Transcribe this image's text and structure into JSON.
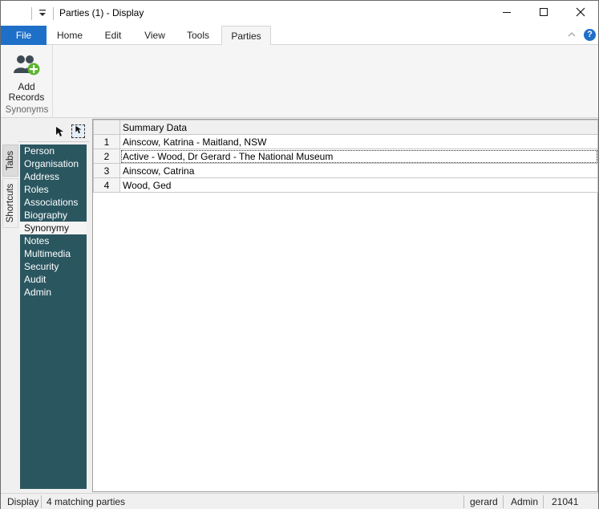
{
  "window": {
    "title": "Parties (1) - Display",
    "quick_access_dropdown_icon": "dropdown-arrow-icon",
    "controls": {
      "minimize": "—",
      "maximize": "☐",
      "close": "✕"
    }
  },
  "ribbon": {
    "tabs": [
      {
        "label": "File"
      },
      {
        "label": "Home"
      },
      {
        "label": "Edit"
      },
      {
        "label": "View"
      },
      {
        "label": "Tools"
      },
      {
        "label": "Parties"
      }
    ],
    "active_tab": "Parties",
    "collapse_icon": "^",
    "help_icon": "?",
    "groups": [
      {
        "label": "Synonyms",
        "buttons": [
          {
            "label_line1": "Add",
            "label_line2": "Records",
            "icon": "add-people-icon"
          }
        ]
      }
    ],
    "colors": {
      "file_tab": "#1e6fc8",
      "add_icon_people": "#3d4a52",
      "add_icon_plus": "#5cb531"
    }
  },
  "sidebar": {
    "vertical_tabs": [
      {
        "label": "Tabs"
      },
      {
        "label": "Shortcuts"
      }
    ],
    "tools": {
      "pointer": "↖",
      "select": "⇱"
    },
    "items": [
      {
        "label": "Person"
      },
      {
        "label": "Organisation"
      },
      {
        "label": "Address"
      },
      {
        "label": "Roles"
      },
      {
        "label": "Associations"
      },
      {
        "label": "Biography"
      },
      {
        "label": "Synonymy"
      },
      {
        "label": "Notes"
      },
      {
        "label": "Multimedia"
      },
      {
        "label": "Security"
      },
      {
        "label": "Audit"
      },
      {
        "label": "Admin"
      }
    ],
    "active_item": "Synonymy",
    "colors": {
      "background": "#2a5660",
      "active_background": "#f4f4f4"
    }
  },
  "grid": {
    "column_header": "Summary Data",
    "rows": [
      {
        "num": "1",
        "value": "Ainscow, Katrina - Maitland, NSW"
      },
      {
        "num": "2",
        "value": "Active - Wood, Dr Gerard - The National Museum"
      },
      {
        "num": "3",
        "value": "Ainscow, Catrina"
      },
      {
        "num": "4",
        "value": "Wood, Ged"
      }
    ],
    "selected_row": "2"
  },
  "statusbar": {
    "mode": "Display",
    "summary": "4 matching parties",
    "user": "gerard",
    "group": "Admin",
    "port": "21041"
  }
}
